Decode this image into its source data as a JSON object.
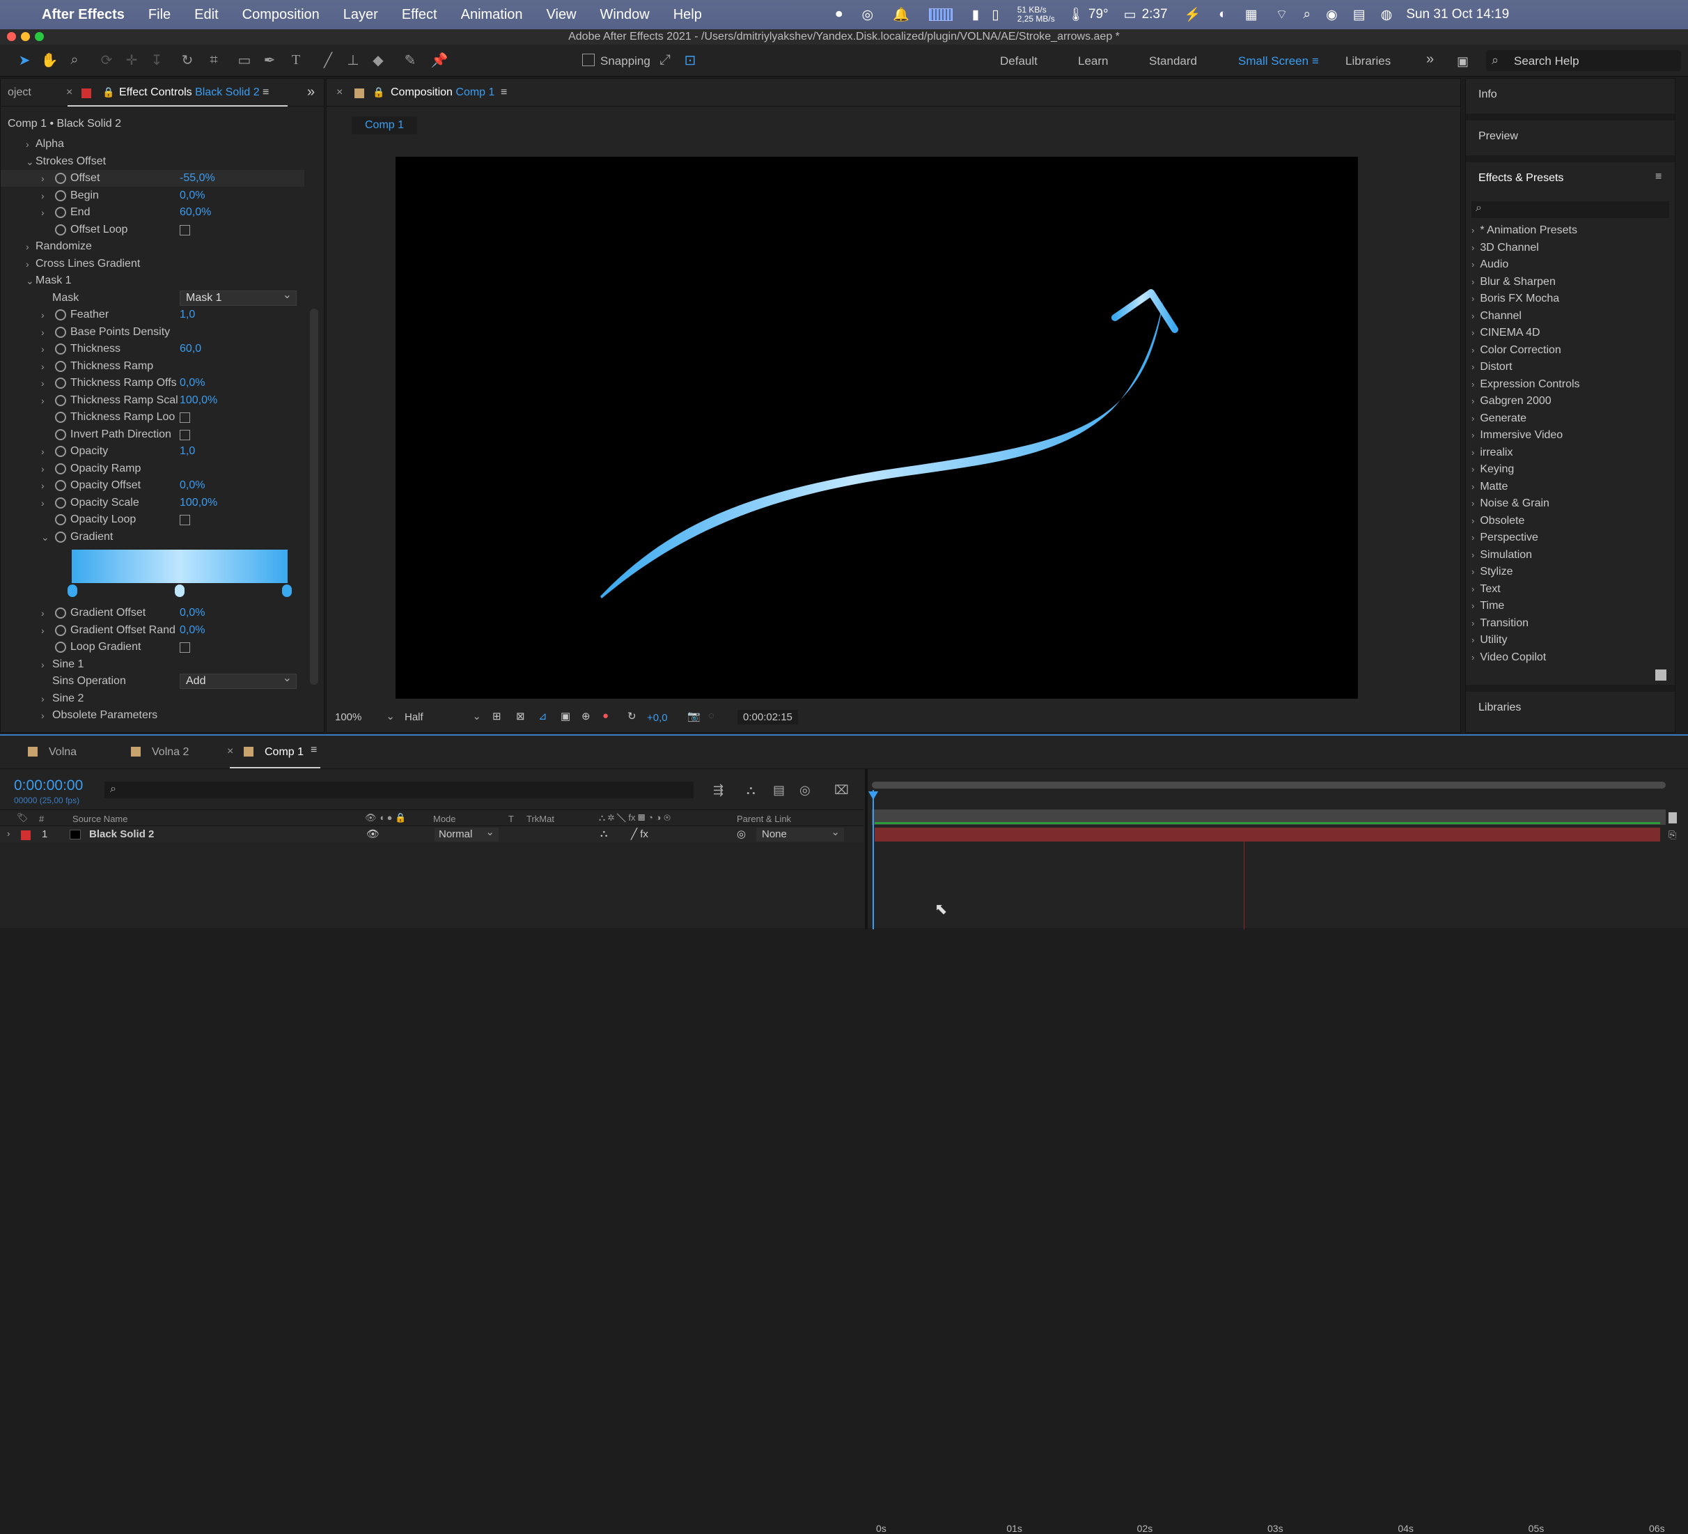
{
  "menubar": {
    "app": "After Effects",
    "items": [
      "File",
      "Edit",
      "Composition",
      "Layer",
      "Effect",
      "Animation",
      "View",
      "Window",
      "Help"
    ],
    "net_up": "51 KB/s",
    "net_down": "2,25 MB/s",
    "temp": "79°",
    "battery_time": "2:37",
    "datetime": "Sun 31 Oct  14:19"
  },
  "window_title": "Adobe After Effects 2021 - /Users/dmitriylyakshev/Yandex.Disk.localized/plugin/VOLNA/AE/Stroke_arrows.aep *",
  "toolbar": {
    "snapping_label": "Snapping",
    "workspaces": [
      "Default",
      "Learn",
      "Standard",
      "Small Screen",
      "Libraries"
    ],
    "active_workspace": "Small Screen",
    "search_placeholder": "Search Help"
  },
  "effect_controls": {
    "project_tab": "oject",
    "tab_label": "Effect Controls",
    "tab_layer": "Black Solid 2",
    "breadcrumb": "Comp 1 • Black Solid 2",
    "rows": [
      {
        "name": "Alpha",
        "indent": 1,
        "type": "group",
        "open": false
      },
      {
        "name": "Strokes Offset",
        "indent": 1,
        "type": "group",
        "open": true
      },
      {
        "name": "Offset",
        "indent": 2,
        "type": "value",
        "value": "-55,0%",
        "selected": true
      },
      {
        "name": "Begin",
        "indent": 2,
        "type": "value",
        "value": "0,0%"
      },
      {
        "name": "End",
        "indent": 2,
        "type": "value",
        "value": "60,0%"
      },
      {
        "name": "Offset Loop",
        "indent": 2,
        "type": "check"
      },
      {
        "name": "Randomize",
        "indent": 1,
        "type": "group",
        "open": false
      },
      {
        "name": "Cross Lines Gradient",
        "indent": 1,
        "type": "group",
        "open": false
      },
      {
        "name": "Mask 1",
        "indent": 1,
        "type": "group",
        "open": true
      },
      {
        "name": "Mask",
        "indent": 3,
        "type": "dropdown",
        "value": "Mask 1"
      },
      {
        "name": "Feather",
        "indent": 2,
        "type": "value",
        "value": "1,0"
      },
      {
        "name": "Base Points Density",
        "indent": 2,
        "type": "value",
        "value": ""
      },
      {
        "name": "Thickness",
        "indent": 2,
        "type": "value",
        "value": "60,0"
      },
      {
        "name": "Thickness Ramp",
        "indent": 2,
        "type": "value",
        "value": ""
      },
      {
        "name": "Thickness Ramp Offs",
        "indent": 2,
        "type": "value",
        "value": "0,0%"
      },
      {
        "name": "Thickness Ramp Scal",
        "indent": 2,
        "type": "value",
        "value": "100,0%"
      },
      {
        "name": "Thickness Ramp Loo",
        "indent": 2,
        "type": "check"
      },
      {
        "name": "Invert Path Direction",
        "indent": 2,
        "type": "check"
      },
      {
        "name": "Opacity",
        "indent": 2,
        "type": "value",
        "value": "1,0"
      },
      {
        "name": "Opacity Ramp",
        "indent": 2,
        "type": "value",
        "value": ""
      },
      {
        "name": "Opacity Offset",
        "indent": 2,
        "type": "value",
        "value": "0,0%"
      },
      {
        "name": "Opacity Scale",
        "indent": 2,
        "type": "value",
        "value": "100,0%"
      },
      {
        "name": "Opacity Loop",
        "indent": 2,
        "type": "check"
      },
      {
        "name": "Gradient",
        "indent": 2,
        "type": "gradient"
      }
    ],
    "rows_after": [
      {
        "name": "Gradient Offset",
        "indent": 2,
        "type": "value",
        "value": "0,0%"
      },
      {
        "name": "Gradient Offset Rand",
        "indent": 2,
        "type": "value",
        "value": "0,0%"
      },
      {
        "name": "Loop Gradient",
        "indent": 2,
        "type": "check"
      },
      {
        "name": "Sine 1",
        "indent": 4,
        "type": "group",
        "open": false
      },
      {
        "name": "Sins Operation",
        "indent": 3,
        "type": "dropdown",
        "value": "Add"
      },
      {
        "name": "Sine 2",
        "indent": 4,
        "type": "group",
        "open": false
      },
      {
        "name": "Obsolete Parameters",
        "indent": 4,
        "type": "group",
        "open": false
      }
    ]
  },
  "composition": {
    "tab_label": "Composition",
    "tab_comp": "Comp 1",
    "subtab": "Comp 1",
    "zoom": "100%",
    "resolution": "Half",
    "exposure": "+0,0",
    "timecode": "0:00:02:15"
  },
  "right_panel": {
    "info": "Info",
    "preview": "Preview",
    "effects_presets": "Effects & Presets",
    "libraries": "Libraries",
    "categories": [
      "* Animation Presets",
      "3D Channel",
      "Audio",
      "Blur & Sharpen",
      "Boris FX Mocha",
      "Channel",
      "CINEMA 4D",
      "Color Correction",
      "Distort",
      "Expression Controls",
      "Gabgren 2000",
      "Generate",
      "Immersive Video",
      "irrealix",
      "Keying",
      "Matte",
      "Noise & Grain",
      "Obsolete",
      "Perspective",
      "Simulation",
      "Stylize",
      "Text",
      "Time",
      "Transition",
      "Utility",
      "Video Copilot"
    ]
  },
  "timeline": {
    "tabs": [
      "Volna",
      "Volna 2",
      "Comp 1"
    ],
    "active_tab": "Comp 1",
    "timecode": "0:00:00:00",
    "fps": "00000 (25,00 fps)",
    "columns": {
      "source": "Source Name",
      "mode": "Mode",
      "t": "T",
      "trkmat": "TrkMat",
      "parent": "Parent & Link"
    },
    "layer": {
      "num": "1",
      "name": "Black Solid 2",
      "mode": "Normal",
      "parent": "None"
    },
    "ruler": [
      "0s",
      "01s",
      "02s",
      "03s",
      "04s",
      "05s",
      "06s"
    ]
  },
  "colors": {
    "accent": "#3b9df0",
    "layer_bar": "#7d2c2c",
    "work_area": "#2e9b3b",
    "arrow_light": "#bfe6ff",
    "arrow_dark": "#3aa9ef"
  }
}
